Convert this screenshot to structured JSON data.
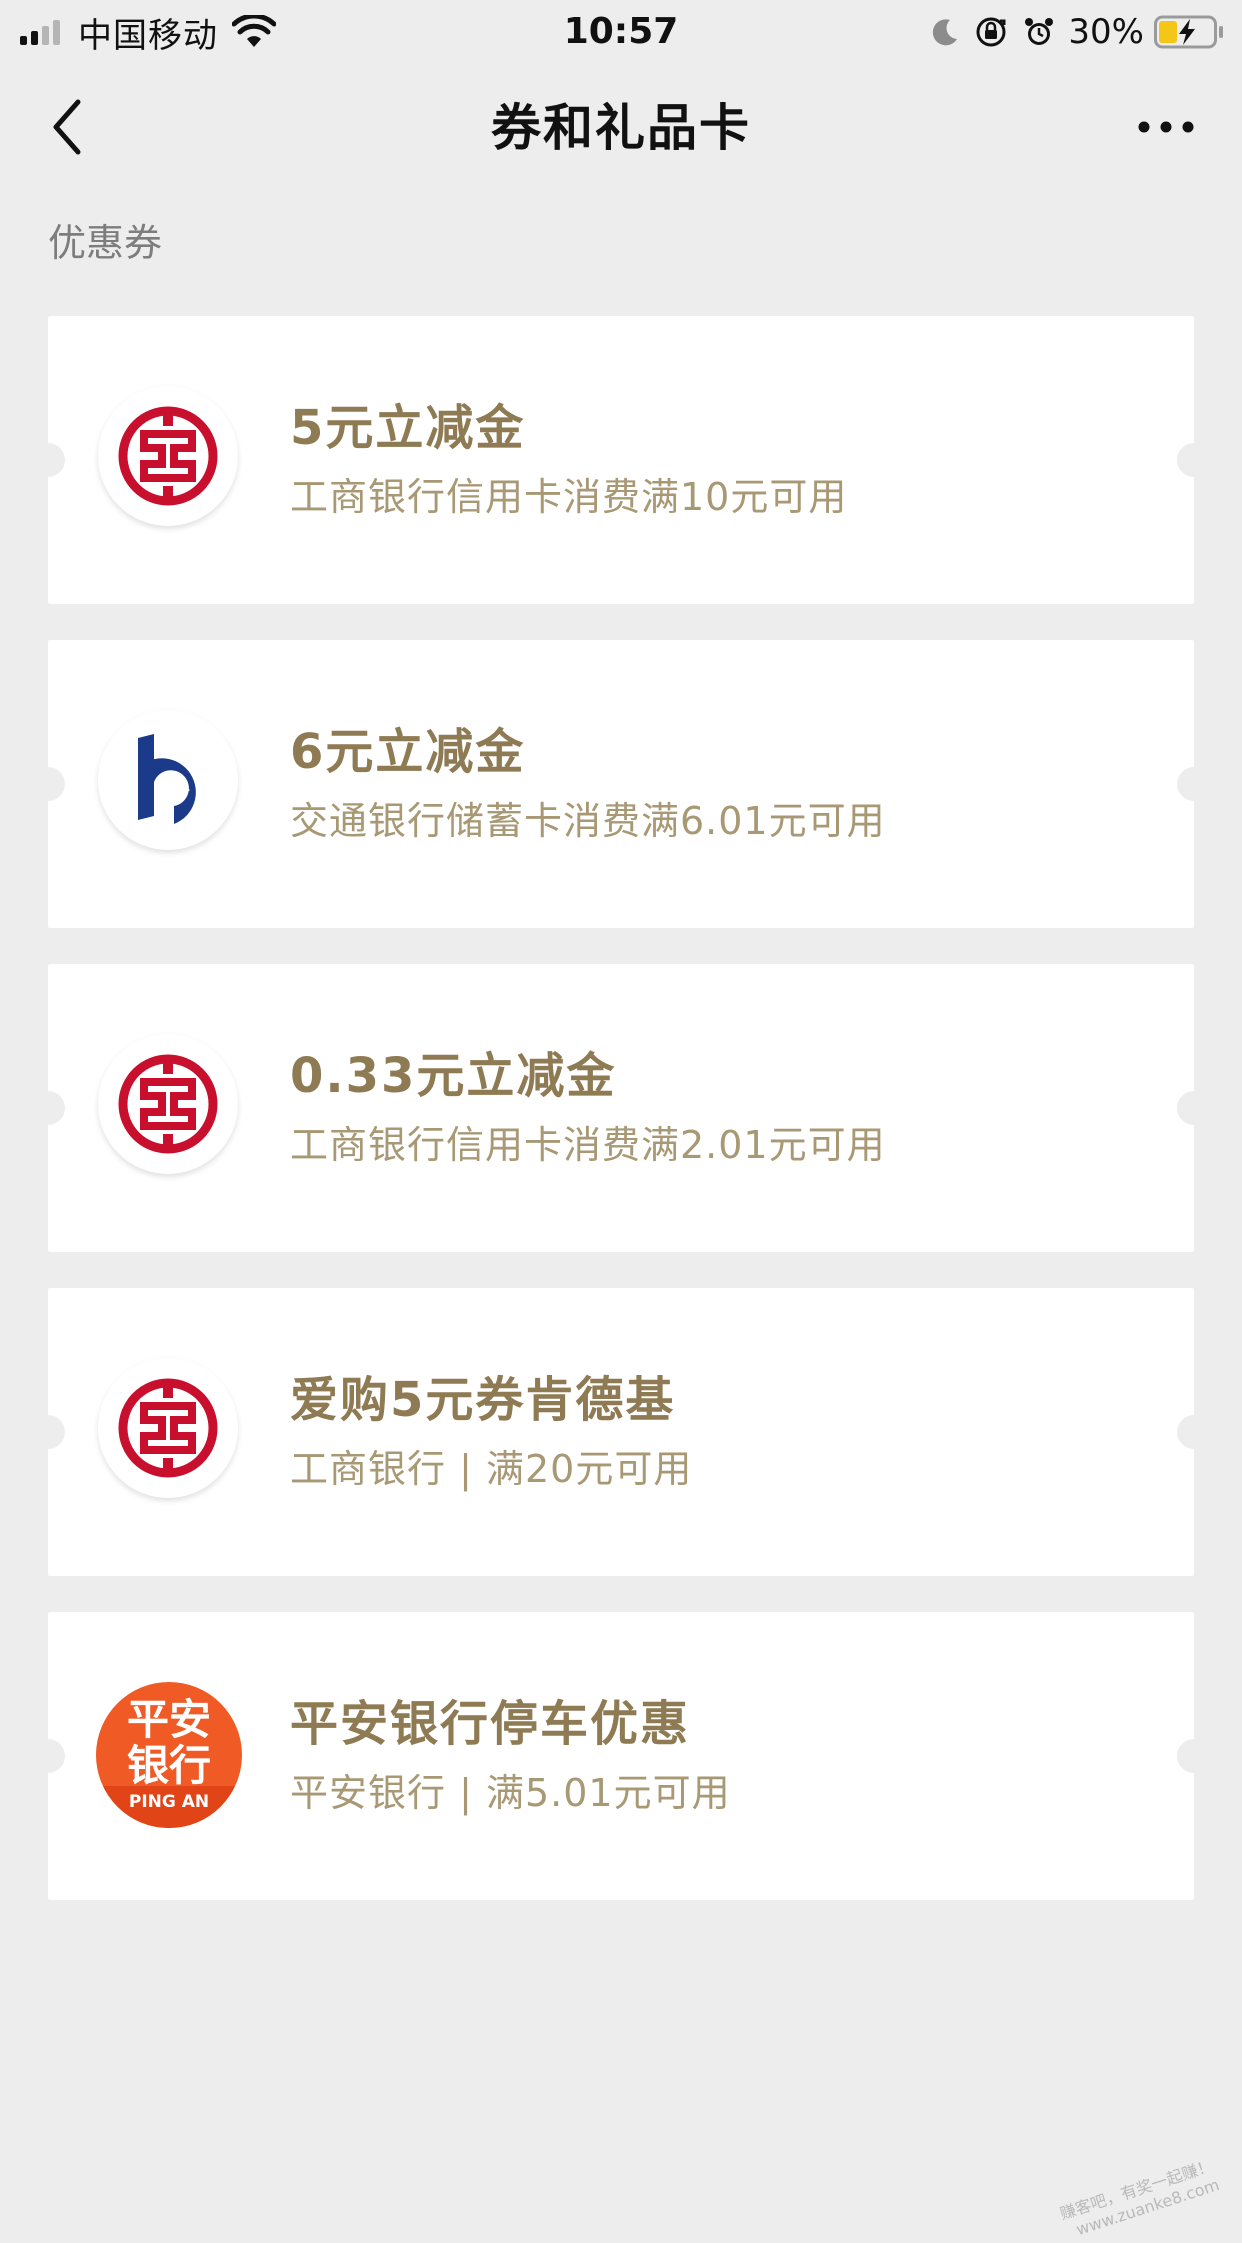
{
  "status_bar": {
    "carrier": "中国移动",
    "time": "10:57",
    "battery_percent": "30%",
    "signal_icon": "signal-bars-icon",
    "wifi_icon": "wifi-icon",
    "dnd_icon": "moon-icon",
    "rotation_lock_icon": "rotation-lock-icon",
    "alarm_icon": "alarm-icon",
    "battery_icon": "battery-charging-icon",
    "battery_color": "#f5c518"
  },
  "nav": {
    "title": "券和礼品卡",
    "back_icon": "chevron-left-icon",
    "more_icon": "more-dots-icon"
  },
  "section": {
    "label": "优惠券"
  },
  "coupons": [
    {
      "title": "5元立减金",
      "desc": "工商银行信用卡消费满10元可用",
      "logo_icon": "icbc-logo-icon"
    },
    {
      "title": "6元立减金",
      "desc": "交通银行储蓄卡消费满6.01元可用",
      "logo_icon": "bocom-logo-icon"
    },
    {
      "title": "0.33元立减金",
      "desc": "工商银行信用卡消费满2.01元可用",
      "logo_icon": "icbc-logo-icon"
    },
    {
      "title": "爱购5元券肯德基",
      "desc": "工商银行 | 满20元可用",
      "logo_icon": "icbc-logo-icon"
    },
    {
      "title": "平安银行停车优惠",
      "desc": "平安银行 | 满5.01元可用",
      "logo_icon": "pingan-logo-icon",
      "logo_text_line1": "平安",
      "logo_text_line2": "银行",
      "logo_text_line3": "PING AN"
    }
  ],
  "colors": {
    "background": "#ededed",
    "card": "#ffffff",
    "coupon_title": "#8e7a53",
    "coupon_desc": "#a89874",
    "icbc_red": "#c8102e",
    "bocom_blue": "#1b3b8a",
    "pingan_orange": "#f05a24"
  },
  "watermark": {
    "line1": "赚客吧，有奖一起赚！",
    "line2": "www.zuanke8.com"
  }
}
